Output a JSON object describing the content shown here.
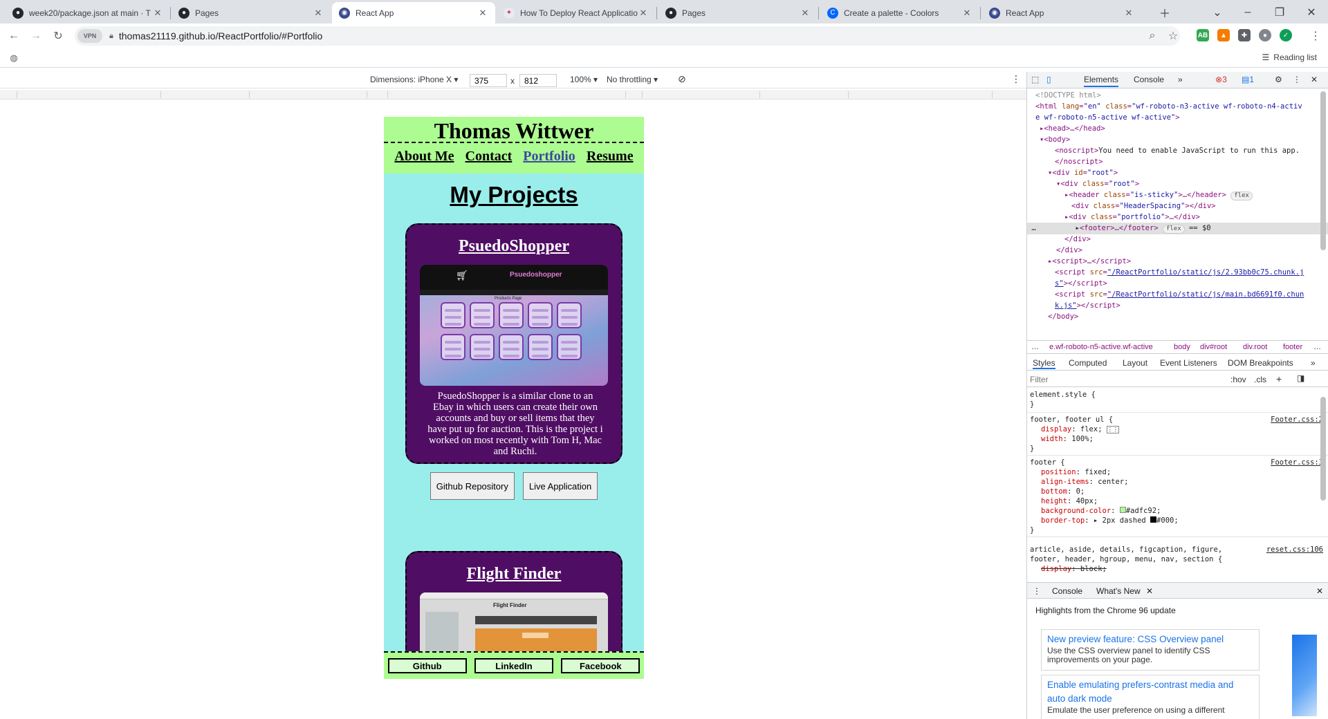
{
  "tabs": [
    {
      "title": "week20/package.json at main · T",
      "icon": "github-icon"
    },
    {
      "title": "Pages",
      "icon": "github-icon"
    },
    {
      "title": "React App",
      "icon": "react-app-icon"
    },
    {
      "title": "How To Deploy React Applicatio",
      "icon": "article-icon"
    },
    {
      "title": "Pages",
      "icon": "github-icon"
    },
    {
      "title": "Create a palette - Coolors",
      "icon": "coolors-icon"
    },
    {
      "title": "React App",
      "icon": "react-app-icon"
    }
  ],
  "omnibox": {
    "url": "thomas21119.github.io/ReactPortfolio/#Portfolio",
    "vpn": "VPN"
  },
  "bookmarks": {
    "reading_list": "Reading list"
  },
  "device_toolbar": {
    "device": "Dimensions: iPhone X ▾",
    "width": "375",
    "times": "x",
    "height": "812",
    "zoom": "100% ▾",
    "throttling": "No throttling ▾"
  },
  "page": {
    "name": "Thomas Wittwer",
    "nav": [
      "About Me",
      "Contact",
      "Portfolio",
      "Resume"
    ],
    "heading": "My Projects",
    "projects": [
      {
        "title": "PsuedoShopper",
        "screenshot_brand": "Psuedoshopper",
        "screenshot_caption": "Products Page",
        "description": "PsuedoShopper is a similar clone to an Ebay in which users can create their own accounts and buy or sell items that they have put up for auction. This is the project i worked on most recently with Tom H, Mac and Ruchi.",
        "buttons": [
          "Github Repository",
          "Live Application"
        ]
      },
      {
        "title": "Flight Finder",
        "screenshot_brand": "Flight Finder"
      }
    ],
    "footer": [
      "Github",
      "LinkedIn",
      "Facebook"
    ]
  },
  "devtools": {
    "tabs": [
      "Elements",
      "Console"
    ],
    "errors": "3",
    "messages": "1",
    "breadcrumbs": [
      "…",
      "e.wf-roboto-n5-active.wf-active",
      "body",
      "div#root",
      "div.root",
      "footer",
      "…"
    ],
    "style_tabs": [
      "Styles",
      "Computed",
      "Layout",
      "Event Listeners",
      "DOM Breakpoints"
    ],
    "filter_placeholder": "Filter",
    "hov": ":hov",
    "cls": ".cls",
    "drawer_tabs": [
      "Console",
      "What's New"
    ],
    "whats_new_heading": "Highlights from the Chrome 96 update",
    "whats_new": [
      {
        "title": "New preview feature: CSS Overview panel",
        "desc": "Use the CSS overview panel to identify CSS improvements on your page."
      },
      {
        "title": "Enable emulating prefers-contrast media and auto dark mode",
        "desc": "Emulate the user preference on using a different"
      }
    ]
  }
}
